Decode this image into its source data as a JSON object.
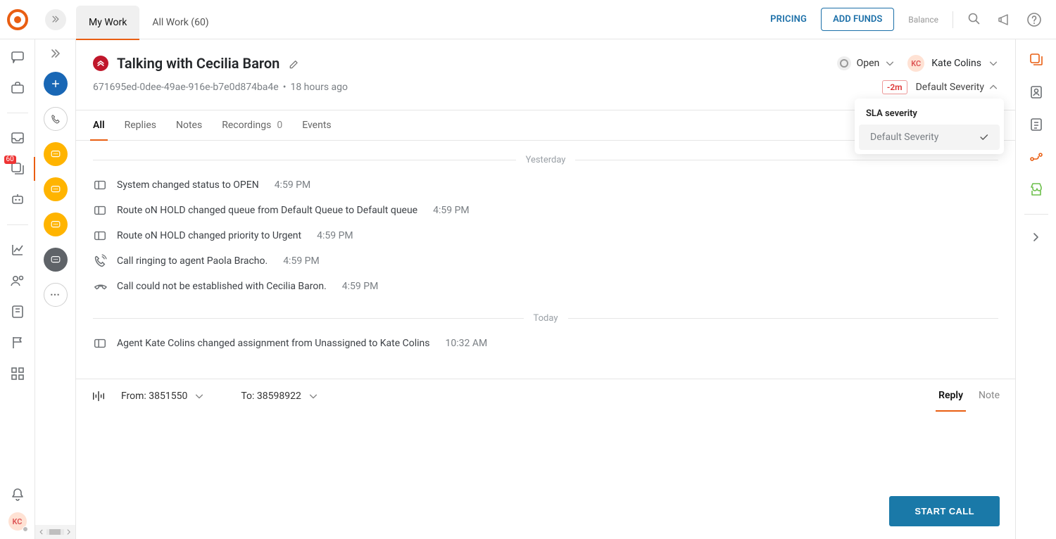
{
  "topbar": {
    "tabs": {
      "my_work": "My Work",
      "all_work": "All Work (60)"
    },
    "pricing": "PRICING",
    "add_funds": "ADD FUNDS",
    "balance": "Balance"
  },
  "rail": {
    "inbox_badge": "60"
  },
  "avatar": {
    "initials": "KC"
  },
  "ticket": {
    "title": "Talking with Cecilia Baron",
    "id": "671695ed-0dee-49ae-916e-b7e0d874ba4e",
    "age": "18 hours ago",
    "status": "Open",
    "assignee_initials": "KC",
    "assignee_name": "Kate Colins",
    "sla_badge": "-2m",
    "severity_label": "Default Severity"
  },
  "severity_panel": {
    "title": "SLA severity",
    "option": "Default Severity"
  },
  "subtabs": {
    "all": "All",
    "replies": "Replies",
    "notes": "Notes",
    "recordings": "Recordings",
    "recordings_count": "0",
    "events": "Events"
  },
  "timeline": {
    "yesterday_label": "Yesterday",
    "today_label": "Today",
    "events": [
      {
        "text": "System changed status to OPEN",
        "time": "4:59 PM"
      },
      {
        "text": "Route oN HOLD changed queue from Default Queue to Default queue",
        "time": "4:59 PM"
      },
      {
        "text": "Route oN HOLD changed priority to Urgent",
        "time": "4:59 PM"
      },
      {
        "text": "Call ringing to agent Paola Bracho.",
        "time": "4:59 PM"
      },
      {
        "text": "Call could not be established with Cecilia Baron.",
        "time": "4:59 PM"
      }
    ],
    "today_events": [
      {
        "text": "Agent Kate Colins changed assignment from Unassigned to Kate Colins",
        "time": "10:32 AM"
      }
    ]
  },
  "composer": {
    "from_label": "From: 3851550",
    "to_label": "To: 38598922",
    "reply_tab": "Reply",
    "note_tab": "Note",
    "start_call": "START CALL"
  }
}
